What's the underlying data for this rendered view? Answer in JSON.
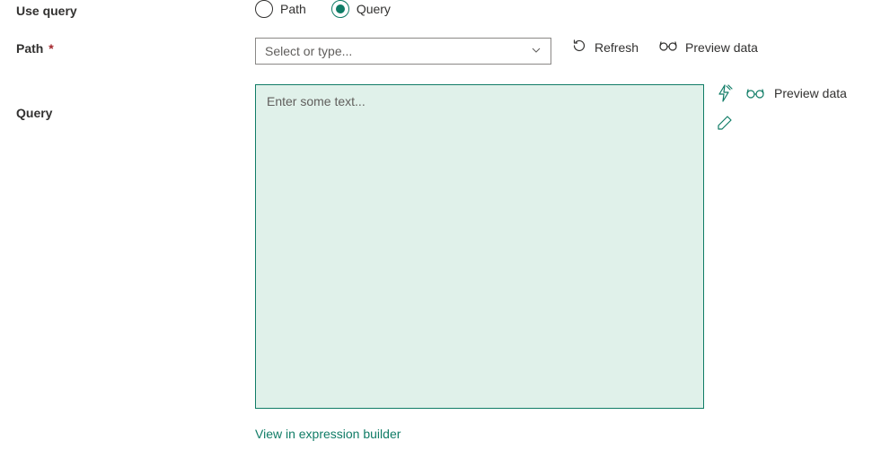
{
  "labels": {
    "use_query": "Use query",
    "path": "Path",
    "path_required": "*",
    "query": "Query"
  },
  "radios": {
    "path": "Path",
    "query": "Query",
    "selected": "query"
  },
  "path_select": {
    "placeholder": "Select or type..."
  },
  "actions": {
    "refresh": "Refresh",
    "preview_data": "Preview data"
  },
  "query_box": {
    "placeholder": "Enter some text..."
  },
  "footer": {
    "view_builder": "View in expression builder"
  }
}
